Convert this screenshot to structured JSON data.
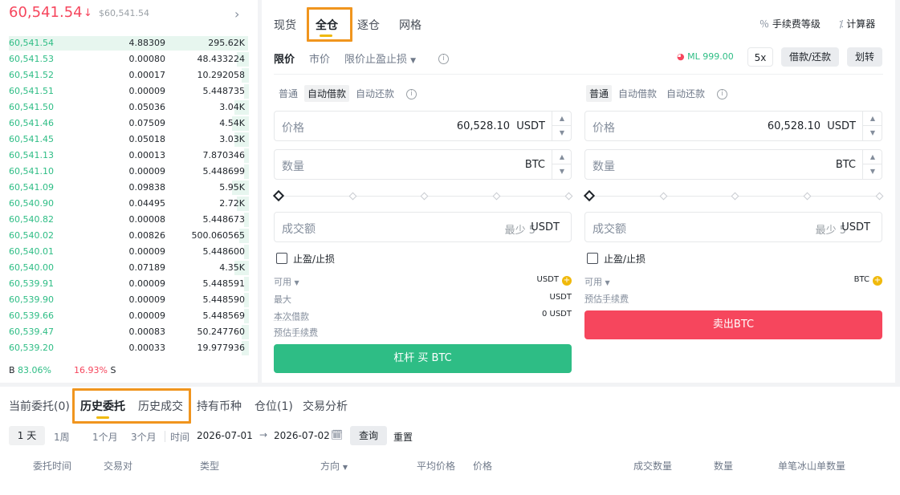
{
  "orderbook": {
    "last_price": "60,541.54",
    "last_price_sub": "$60,541.54",
    "rows": [
      {
        "price": "60,541.54",
        "qty": "4.88309",
        "total": "295.62K"
      },
      {
        "price": "60,541.53",
        "qty": "0.00080",
        "total": "48.433224"
      },
      {
        "price": "60,541.52",
        "qty": "0.00017",
        "total": "10.292058"
      },
      {
        "price": "60,541.51",
        "qty": "0.00009",
        "total": "5.448735"
      },
      {
        "price": "60,541.50",
        "qty": "0.05036",
        "total": "3.04K"
      },
      {
        "price": "60,541.46",
        "qty": "0.07509",
        "total": "4.54K"
      },
      {
        "price": "60,541.45",
        "qty": "0.05018",
        "total": "3.03K"
      },
      {
        "price": "60,541.13",
        "qty": "0.00013",
        "total": "7.870346"
      },
      {
        "price": "60,541.10",
        "qty": "0.00009",
        "total": "5.448699"
      },
      {
        "price": "60,541.09",
        "qty": "0.09838",
        "total": "5.95K"
      },
      {
        "price": "60,540.90",
        "qty": "0.04495",
        "total": "2.72K"
      },
      {
        "price": "60,540.82",
        "qty": "0.00008",
        "total": "5.448673"
      },
      {
        "price": "60,540.02",
        "qty": "0.00826",
        "total": "500.060565"
      },
      {
        "price": "60,540.01",
        "qty": "0.00009",
        "total": "5.448600"
      },
      {
        "price": "60,540.00",
        "qty": "0.07189",
        "total": "4.35K"
      },
      {
        "price": "60,539.91",
        "qty": "0.00009",
        "total": "5.448591"
      },
      {
        "price": "60,539.90",
        "qty": "0.00009",
        "total": "5.448590"
      },
      {
        "price": "60,539.66",
        "qty": "0.00009",
        "total": "5.448569"
      },
      {
        "price": "60,539.47",
        "qty": "0.00083",
        "total": "50.247760"
      },
      {
        "price": "60,539.20",
        "qty": "0.00033",
        "total": "19.977936"
      }
    ],
    "depth_fill": [
      1.0,
      0.05,
      0.03,
      0.02,
      0.06,
      0.07,
      0.06,
      0.02,
      0.02,
      0.07,
      0.05,
      0.02,
      0.04,
      0.02,
      0.06,
      0.02,
      0.02,
      0.02,
      0.03,
      0.03
    ],
    "buy_label": "B",
    "buy_ratio": "83.06%",
    "sell_ratio": "16.93%",
    "sell_label": "S"
  },
  "mode_tabs": [
    "现货",
    "全仓",
    "逐仓",
    "网格"
  ],
  "top_links": {
    "fee_level": "手续费等级",
    "calculator": "计算器"
  },
  "order_types": {
    "limit": "限价",
    "market": "市价",
    "tp_sl": "限价止盈止损"
  },
  "margin": {
    "ml": "ML 999.00",
    "leverage": "5x",
    "borrow_repay": "借款/还款",
    "transfer": "划转"
  },
  "buy_side": {
    "subtabs": [
      "普通",
      "自动借款",
      "自动还款"
    ],
    "price_label": "价格",
    "price_value": "60,528.10",
    "price_unit": "USDT",
    "qty_label": "数量",
    "qty_unit": "BTC",
    "amount_label": "成交额",
    "amount_min": "最少 5",
    "amount_unit": "USDT",
    "tpsl_label": "止盈/止损",
    "available_label": "可用",
    "available_value": "USDT",
    "max_label": "最大",
    "max_value": "USDT",
    "borrow_label": "本次借款",
    "borrow_value": "0 USDT",
    "fee_label": "预估手续费",
    "button": "杠杆 买 BTC"
  },
  "sell_side": {
    "subtabs": [
      "普通",
      "自动借款",
      "自动还款"
    ],
    "price_label": "价格",
    "price_value": "60,528.10",
    "price_unit": "USDT",
    "qty_label": "数量",
    "qty_unit": "BTC",
    "amount_label": "成交额",
    "amount_min": "最少 5",
    "amount_unit": "USDT",
    "tpsl_label": "止盈/止损",
    "available_label": "可用",
    "available_value": "BTC",
    "fee_label": "预估手续费",
    "button": "卖出BTC"
  },
  "bottom": {
    "tabs": [
      "当前委托(0)",
      "历史委托",
      "历史成交",
      "持有币种",
      "仓位(1)",
      "交易分析"
    ],
    "ranges": [
      "1 天",
      "1周",
      "1个月",
      "3个月"
    ],
    "time_label": "时间",
    "date_from": "2026-07-01",
    "date_to": "2026-07-02",
    "query": "查询",
    "reset": "重置",
    "columns": [
      "委托时间",
      "交易对",
      "类型",
      "方向",
      "平均价格",
      "价格",
      "成交数量",
      "数量",
      "单笔冰山单数量"
    ]
  }
}
